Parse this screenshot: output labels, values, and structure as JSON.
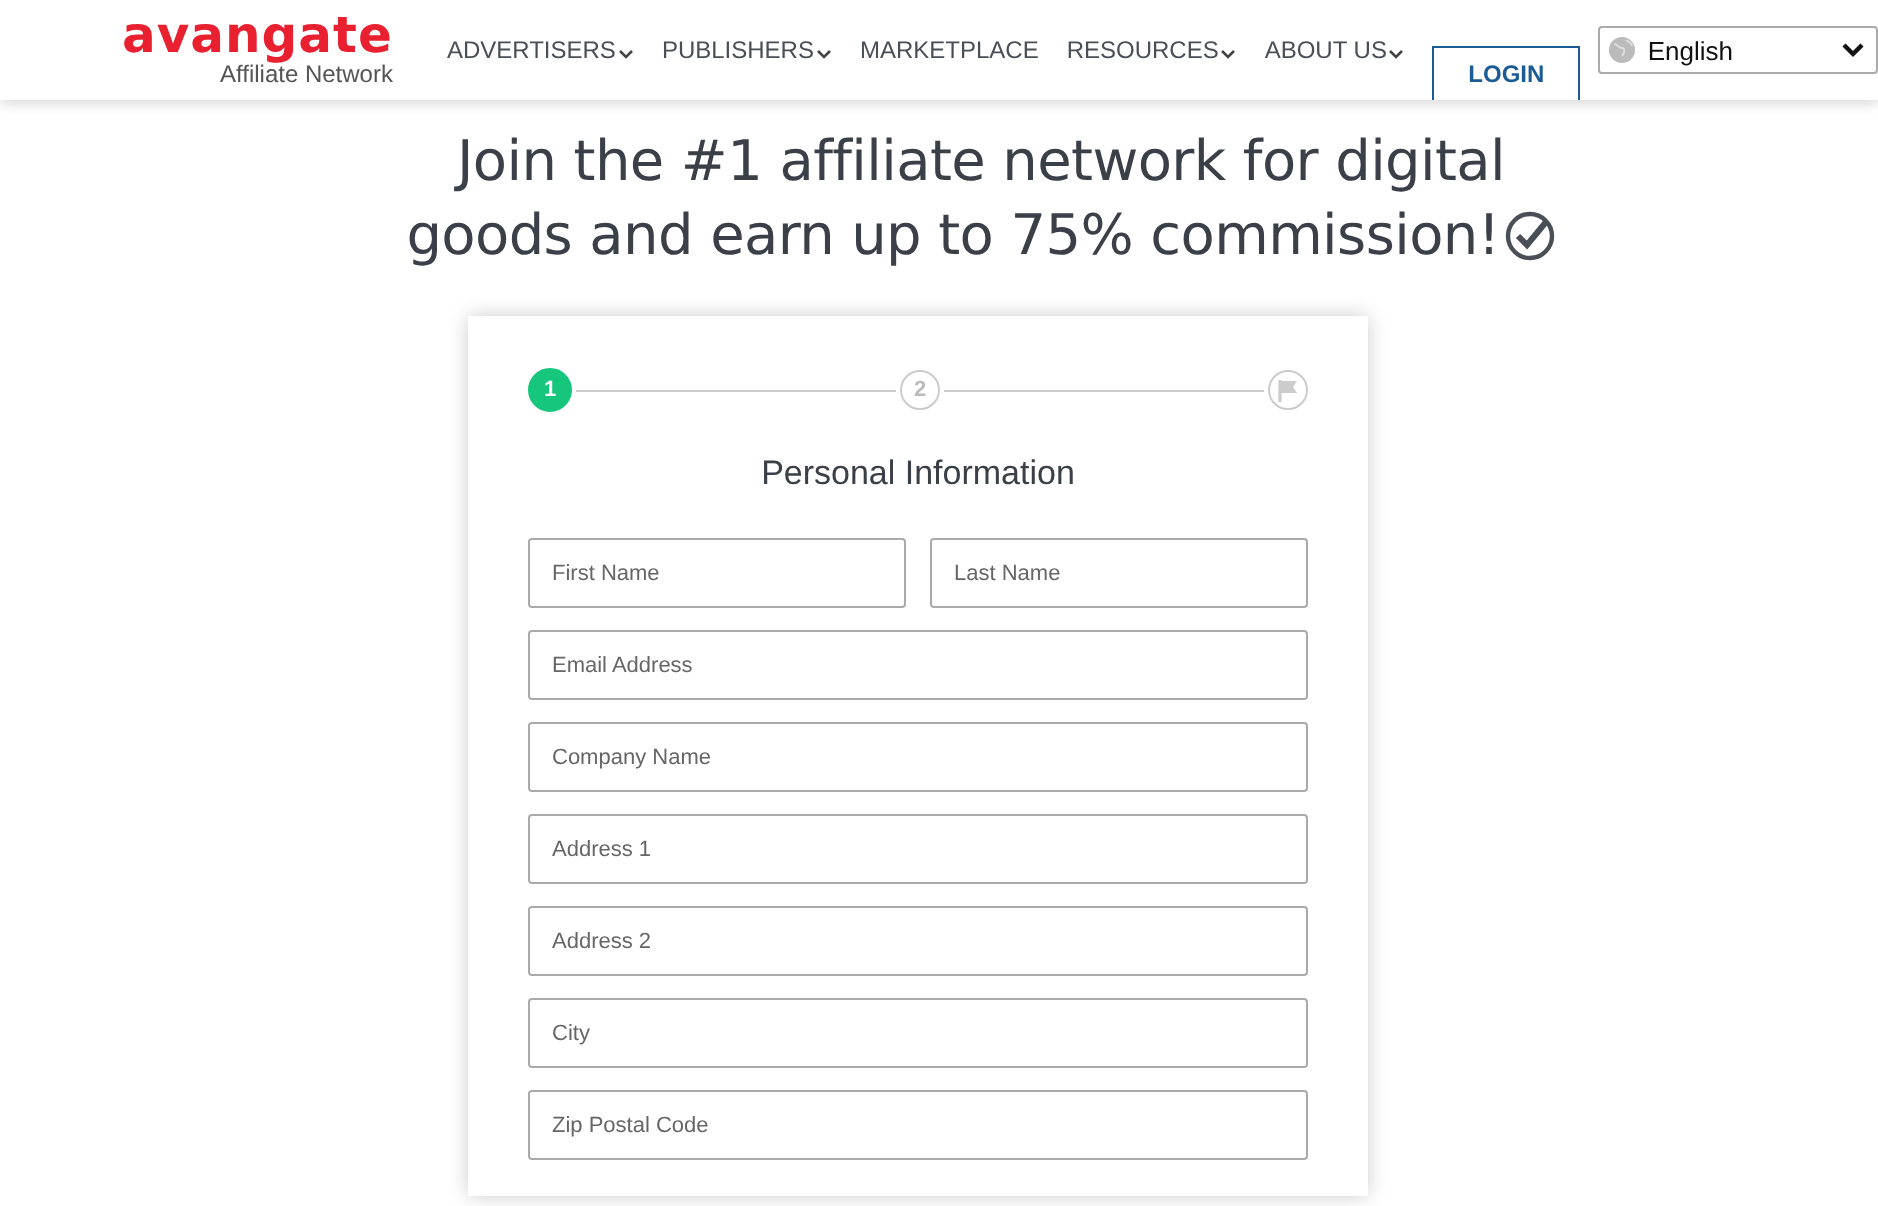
{
  "header": {
    "logo": "avangate",
    "logo_subtitle": "Affiliate Network",
    "nav": [
      {
        "label": "ADVERTISERS",
        "dropdown": true
      },
      {
        "label": "PUBLISHERS",
        "dropdown": true
      },
      {
        "label": "MARKETPLACE",
        "dropdown": false
      },
      {
        "label": "RESOURCES",
        "dropdown": true
      },
      {
        "label": "ABOUT US",
        "dropdown": true
      }
    ],
    "login_button": "LOGIN",
    "language": "English"
  },
  "headline": "Join the #1 affiliate network for digital goods and earn up to 75% commission!",
  "form": {
    "steps": [
      {
        "kind": "number",
        "label": "1",
        "selected": true
      },
      {
        "kind": "number",
        "label": "2",
        "selected": false
      },
      {
        "kind": "flag",
        "selected": false
      }
    ],
    "title": "Personal Information",
    "rows": [
      [
        {
          "placeholder": "First Name"
        },
        {
          "placeholder": "Last Name"
        }
      ],
      [
        {
          "placeholder": "Email Address"
        }
      ],
      [
        {
          "placeholder": "Company Name"
        }
      ],
      [
        {
          "placeholder": "Address 1"
        }
      ],
      [
        {
          "placeholder": "Address 2"
        }
      ],
      [
        {
          "placeholder": "City"
        }
      ],
      [
        {
          "placeholder": "Zip Postal Code"
        }
      ]
    ]
  }
}
